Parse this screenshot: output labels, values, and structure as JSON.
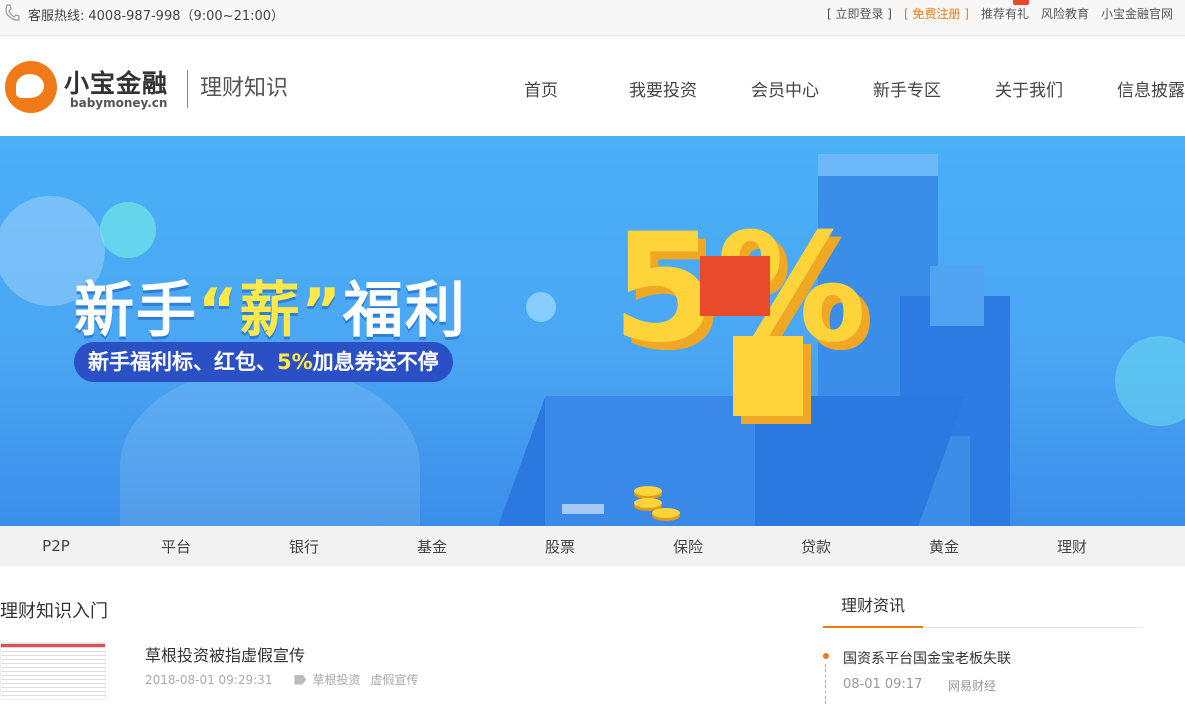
{
  "topbar": {
    "hotline_label": "客服热线:",
    "hotline_number": "4008-987-998（9:00~21:00）",
    "links": [
      {
        "label": "[ 立即登录 ]"
      },
      {
        "label": "[ 免费注册 ]"
      },
      {
        "label": "推荐有礼"
      },
      {
        "label": "风险教育"
      },
      {
        "label": "小宝金融官网"
      }
    ]
  },
  "header": {
    "logo_text": "小宝金融",
    "logo_sub": "babymoney.cn",
    "section_title": "理财知识",
    "nav": [
      "首页",
      "我要投资",
      "会员中心",
      "新手专区",
      "关于我们",
      "信息披露"
    ]
  },
  "banner": {
    "headline_pre": "新手",
    "headline_quote": "“薪”",
    "headline_post": "福利",
    "pill_pre": "新手福利标、红包、",
    "pill_pct": "5%",
    "pill_post": "加息券送不停",
    "big_number": "5%"
  },
  "categories": [
    "P2P",
    "平台",
    "银行",
    "基金",
    "股票",
    "保险",
    "贷款",
    "黄金",
    "理财"
  ],
  "main": {
    "intro_title": "理财知识入门",
    "article": {
      "title": "草根投资被指虚假宣传",
      "date": "2018-08-01 09:29:31",
      "tags": [
        "草根投资",
        "虚假宣传"
      ]
    }
  },
  "news": {
    "title": "理财资讯",
    "item_title": "国资系平台国金宝老板失联",
    "item_date": "08-01 09:17",
    "item_source": "网易财经"
  },
  "colors": {
    "accent": "#f07a18",
    "banner": "#4aa6f3"
  }
}
